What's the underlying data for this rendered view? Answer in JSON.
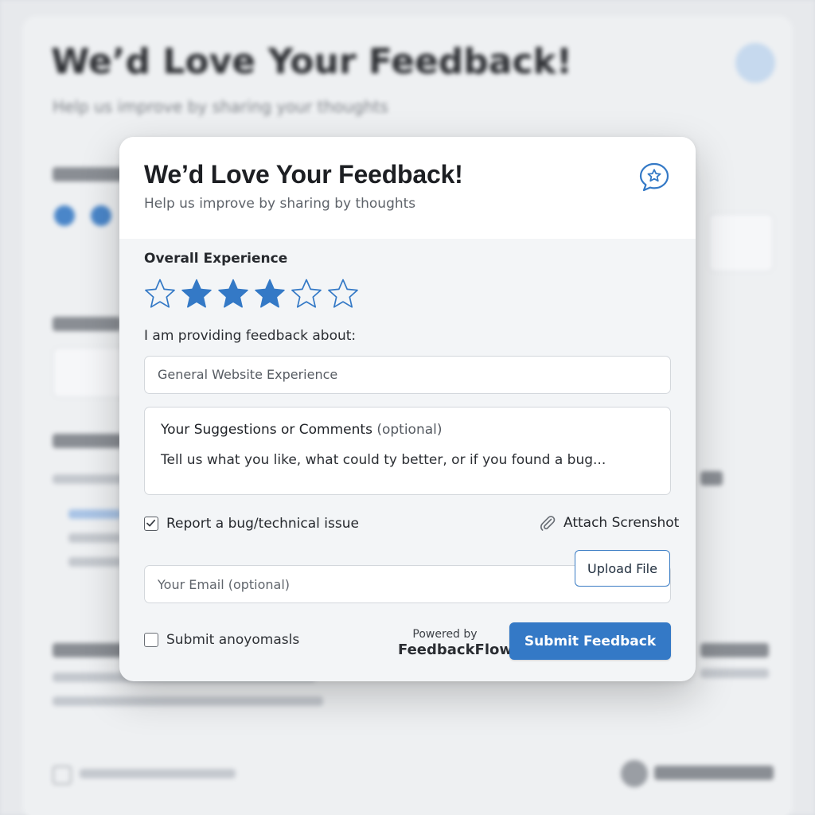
{
  "background": {
    "title": "We’d Love Your Feedback!",
    "subtitle": "Help us improve by sharing your thoughts"
  },
  "modal": {
    "title": "We’d Love Your Feedback!",
    "subtitle": "Help us improve by sharing by thoughts",
    "header_icon": "chat-star-icon",
    "rating": {
      "label": "Overall Experience",
      "value": 3,
      "max": 5,
      "filled_color": "#3479c6"
    },
    "topic": {
      "label": "I am providing feedback about:",
      "value": "General Website Experience"
    },
    "comments": {
      "label": "Your Suggestions or Comments",
      "optional": "(optional)",
      "placeholder": "Tell us what you like, what could ty better, or if you found a bug..."
    },
    "bug_report": {
      "label": "Report a bug/technical issue",
      "checked": true
    },
    "attach": {
      "icon": "paperclip-icon",
      "label": "Attach Screnshot"
    },
    "email": {
      "placeholder": "Your Email (optional)"
    },
    "upload_label": "Upload File",
    "anonymous": {
      "label": "Submit anoyomasls",
      "checked": false
    },
    "powered": {
      "prefix": "Powered by",
      "brand": "FeedbackFlow"
    },
    "submit_label": "Submit Feedback",
    "accent_color": "#3479c6"
  }
}
